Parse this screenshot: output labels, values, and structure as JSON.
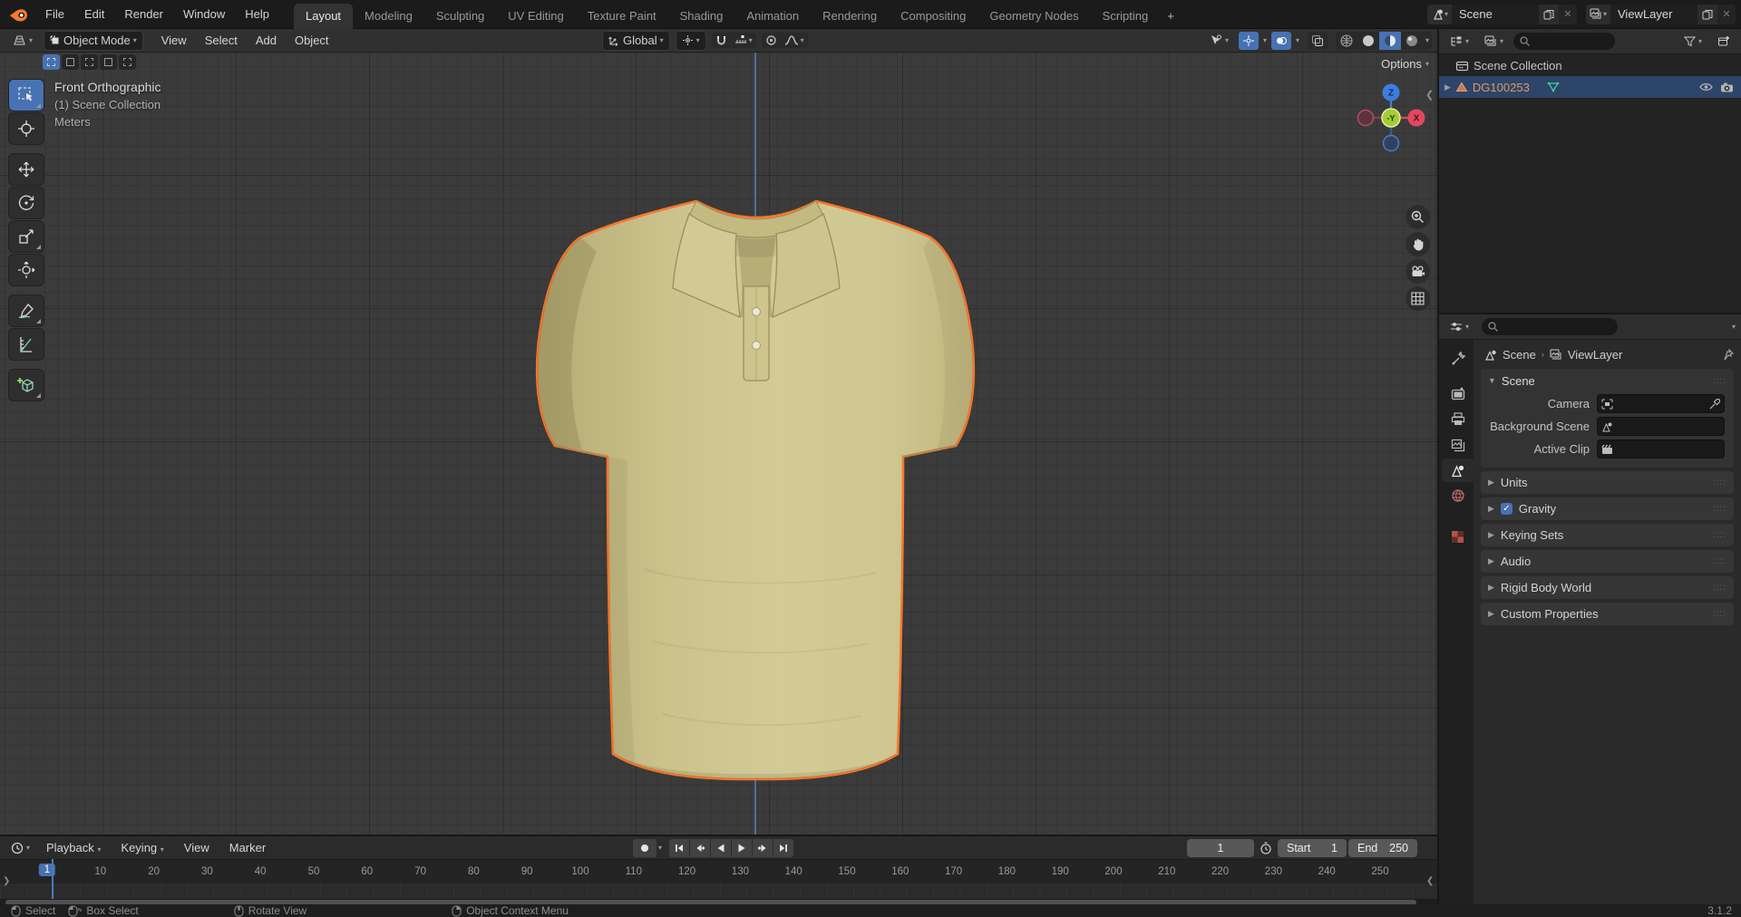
{
  "topbar": {
    "menus": [
      "File",
      "Edit",
      "Render",
      "Window",
      "Help"
    ],
    "tabs": [
      "Layout",
      "Modeling",
      "Sculpting",
      "UV Editing",
      "Texture Paint",
      "Shading",
      "Animation",
      "Rendering",
      "Compositing",
      "Geometry Nodes",
      "Scripting"
    ],
    "active_tab": "Layout",
    "add_tab_label": "+",
    "scene_field": {
      "value": "Scene"
    },
    "viewlayer_field": {
      "value": "ViewLayer"
    }
  },
  "viewport_header": {
    "mode": "Object Mode",
    "menus": [
      "View",
      "Select",
      "Add",
      "Object"
    ],
    "orientation": "Global",
    "options_label": "Options"
  },
  "viewport": {
    "overlay_lines": [
      "Front Orthographic",
      "(1) Scene Collection",
      "Meters"
    ],
    "gizmo": {
      "z": "Z",
      "x": "X",
      "front": "-Y"
    },
    "tools": [
      "select-box",
      "cursor",
      "move",
      "rotate",
      "scale",
      "transform",
      "annotate",
      "measure",
      "add-cube"
    ],
    "nav_icons": [
      "zoom-icon",
      "pan-hand-icon",
      "camera-view-icon",
      "toggle-ortho-grid-icon"
    ]
  },
  "outliner": {
    "collection": "Scene Collection",
    "object": "DG100253",
    "row_icons": [
      "collection-icon",
      "mesh-object-icon",
      "mesh-data-icon",
      "eye-icon",
      "camera-render-icon"
    ]
  },
  "properties": {
    "breadcrumb": {
      "scene": "Scene",
      "viewlayer": "ViewLayer"
    },
    "tabs": [
      "tool",
      "render",
      "output",
      "view-layer",
      "scene",
      "world",
      "texture"
    ],
    "scene_panel": {
      "title": "Scene",
      "camera_label": "Camera",
      "background_label": "Background Scene",
      "clip_label": "Active Clip"
    },
    "sections": [
      "Units",
      "Gravity",
      "Keying Sets",
      "Audio",
      "Rigid Body World",
      "Custom Properties"
    ]
  },
  "timeline": {
    "menus": [
      "Playback",
      "Keying",
      "View",
      "Marker"
    ],
    "current_frame": "1",
    "start_label": "Start",
    "start_value": "1",
    "end_label": "End",
    "end_value": "250",
    "ticks": [
      "1",
      "10",
      "20",
      "30",
      "40",
      "50",
      "60",
      "70",
      "80",
      "90",
      "100",
      "110",
      "120",
      "130",
      "140",
      "150",
      "160",
      "170",
      "180",
      "190",
      "200",
      "210",
      "220",
      "230",
      "240",
      "250"
    ]
  },
  "statusbar": {
    "items": [
      "Select",
      "Box Select",
      "Rotate View",
      "Object Context Menu"
    ],
    "version": "3.1.2"
  },
  "colors": {
    "accent_blue": "#4772b3",
    "selection_outline": "#f8772e",
    "shirt_khaki": "#cfc791",
    "axis_x": "#e24760",
    "axis_y": "#9fcf3c",
    "axis_z": "#3b7de0"
  }
}
